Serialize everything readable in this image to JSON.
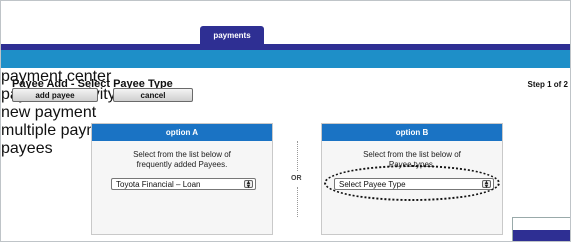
{
  "header": {
    "active_tab": "payments"
  },
  "subnav": {
    "items": [
      "payment center",
      "payment activity",
      "new payment",
      "multiple payments",
      "payees"
    ]
  },
  "page": {
    "title": "Payee Add - Select Payee Type",
    "step": "Step 1 of 2"
  },
  "toolbar": {
    "add_payee_label": "add payee",
    "cancel_label": "cancel"
  },
  "option_a": {
    "title": "option A",
    "desc_line1": "Select from the list below of",
    "desc_line2": "frequently added Payees.",
    "select_value": "Toyota Financial – Loan"
  },
  "or_label": "OR",
  "option_b": {
    "title": "option B",
    "desc_line1": "Select from the list below of",
    "desc_line2": "Payee types.",
    "select_value": "Select Payee Type"
  },
  "colors": {
    "primary_nav": "#2e2f93",
    "subnav": "#1e8fc8",
    "card_header": "#1a73c4"
  }
}
